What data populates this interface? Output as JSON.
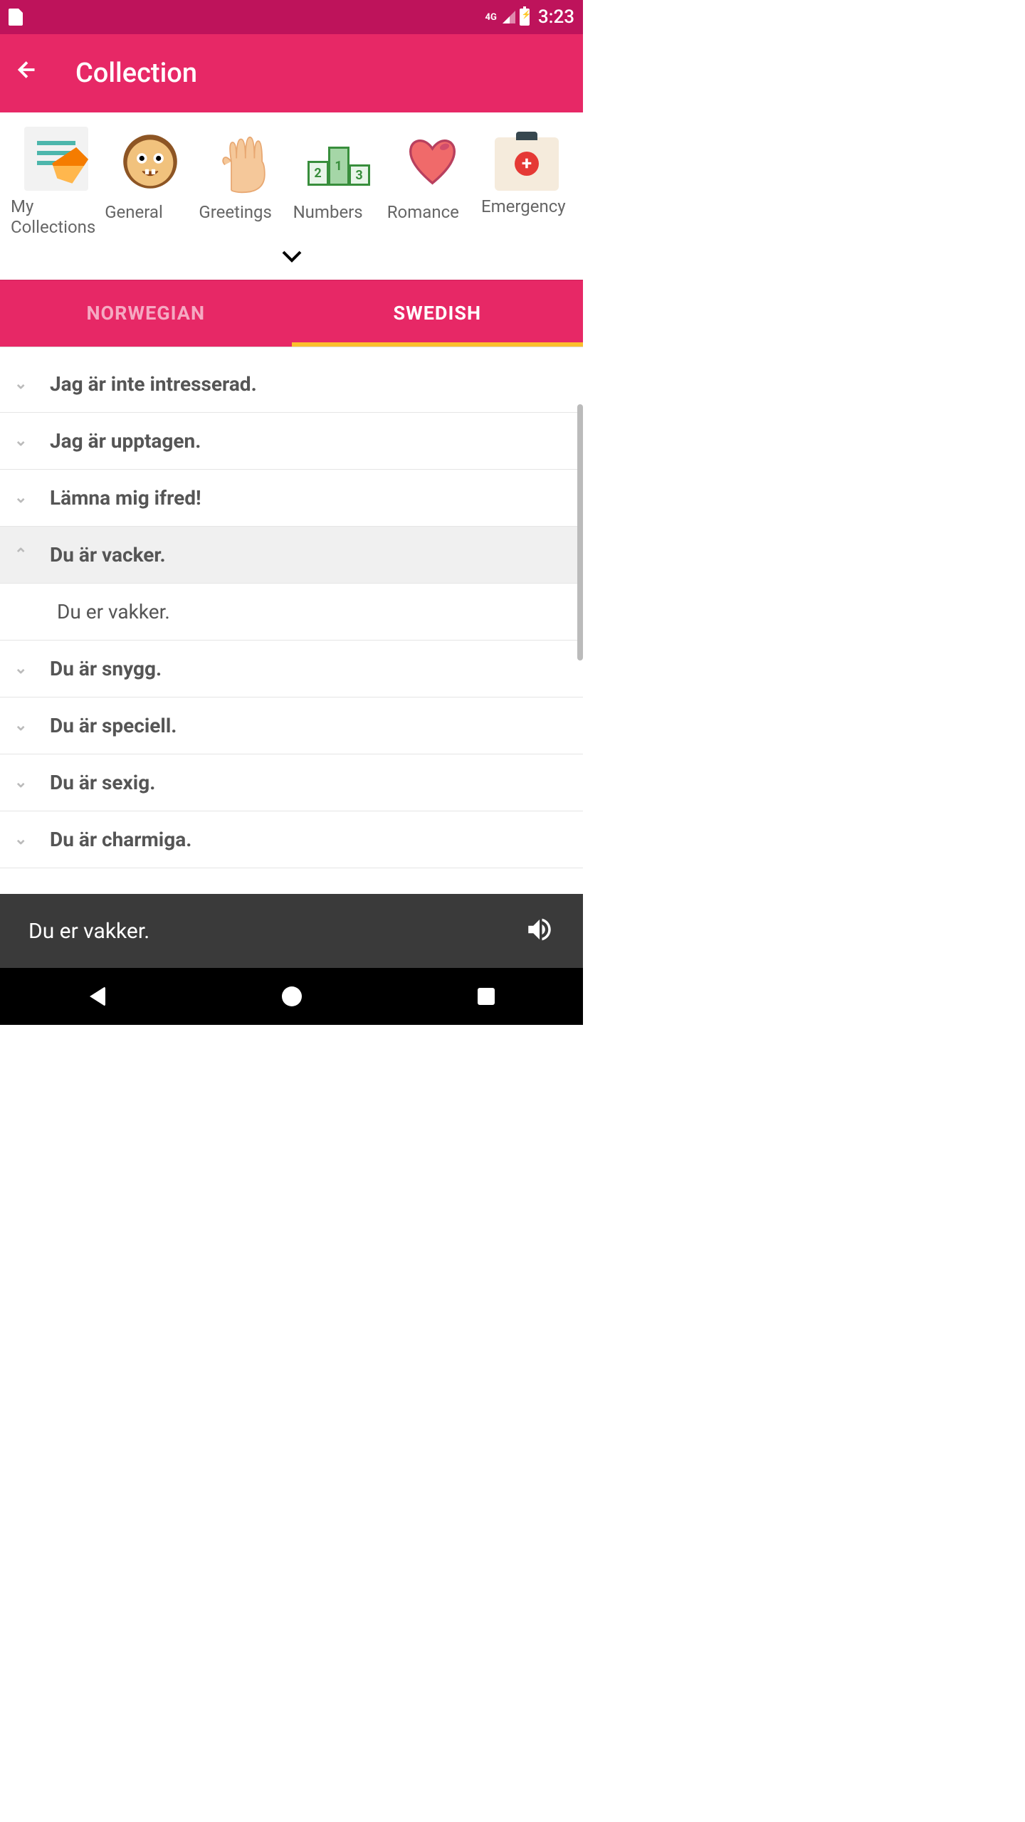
{
  "status": {
    "network": "4G",
    "time": "3:23"
  },
  "header": {
    "title": "Collection"
  },
  "categories": [
    {
      "label": "My Collections",
      "icon": "collections"
    },
    {
      "label": "General",
      "icon": "general"
    },
    {
      "label": "Greetings",
      "icon": "greetings"
    },
    {
      "label": "Numbers",
      "icon": "numbers"
    },
    {
      "label": "Romance",
      "icon": "romance"
    },
    {
      "label": "Emergency",
      "icon": "emergency"
    }
  ],
  "tabs": {
    "left": "NORWEGIAN",
    "right": "SWEDISH",
    "active": "right"
  },
  "phrases": [
    {
      "text": "Jag är inte intresserad.",
      "expanded": false
    },
    {
      "text": "Jag är upptagen.",
      "expanded": false
    },
    {
      "text": "Lämna mig ifred!",
      "expanded": false
    },
    {
      "text": "Du är vacker.",
      "expanded": true,
      "translation": "Du er vakker."
    },
    {
      "text": "Du är snygg.",
      "expanded": false
    },
    {
      "text": "Du är speciell.",
      "expanded": false
    },
    {
      "text": "Du är sexig.",
      "expanded": false
    },
    {
      "text": "Du är charmiga.",
      "expanded": false
    }
  ],
  "player": {
    "text": "Du er vakker."
  }
}
